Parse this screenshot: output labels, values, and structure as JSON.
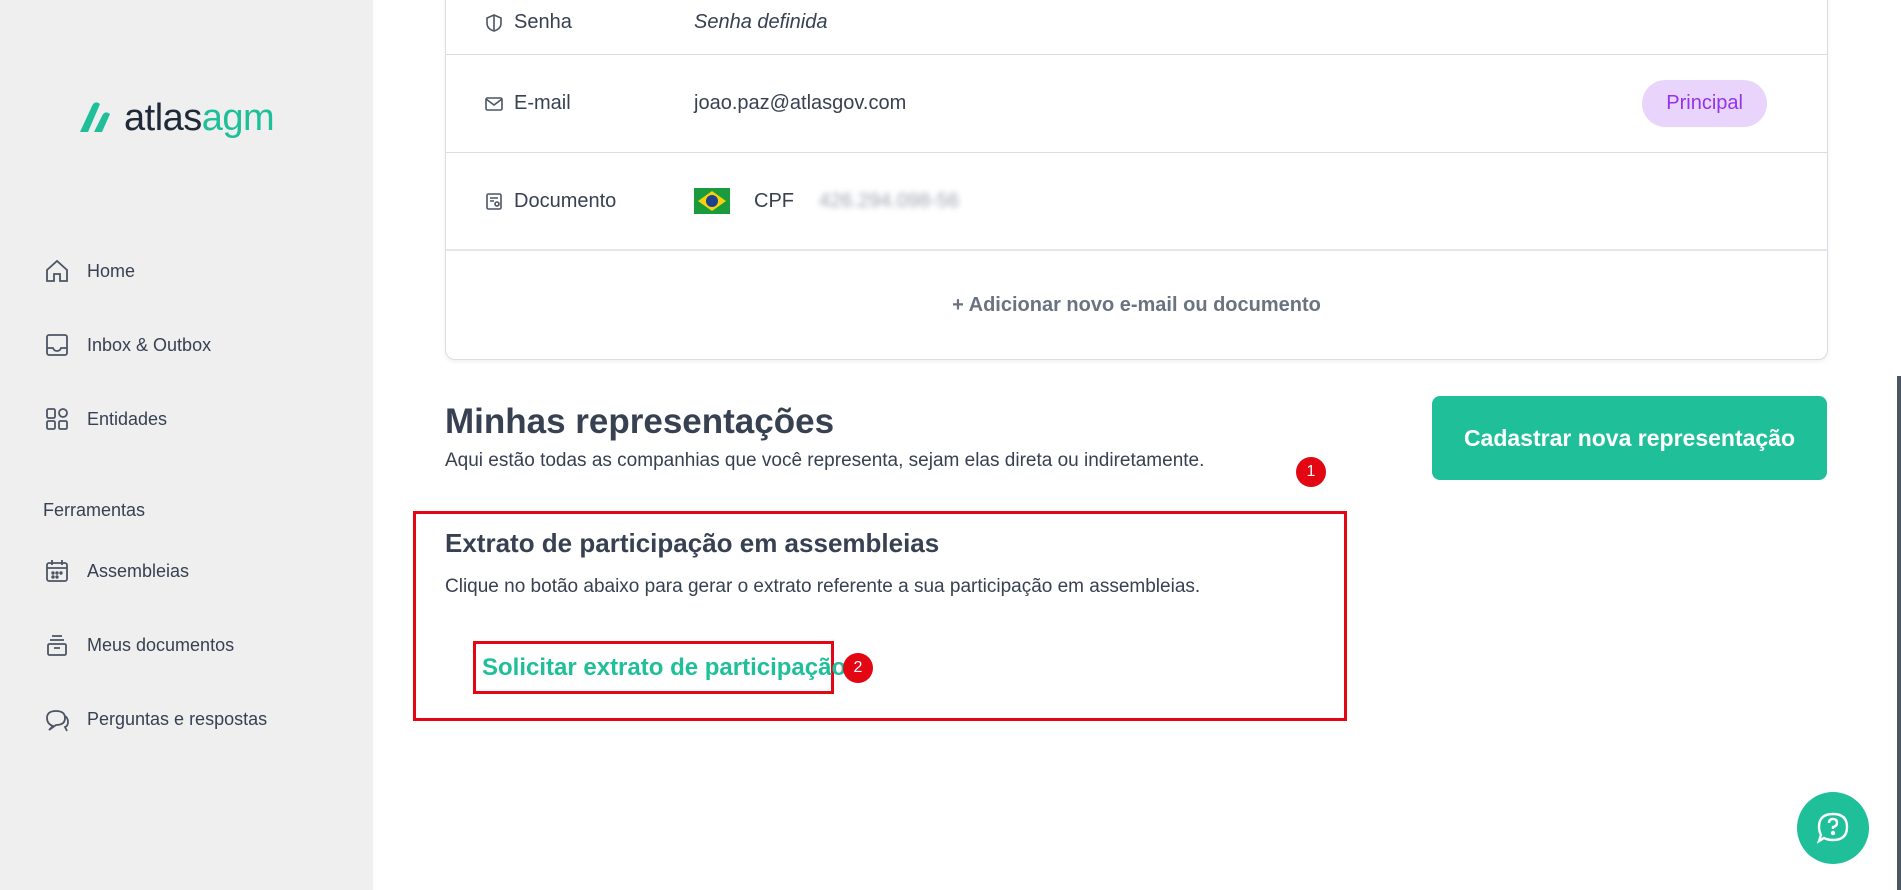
{
  "app": {
    "logo_prefix": "atlas",
    "logo_suffix": "agm",
    "brand_color": "#1fbf9a"
  },
  "sidebar": {
    "items": [
      {
        "label": "Home",
        "icon": "home-icon"
      },
      {
        "label": "Inbox & Outbox",
        "icon": "inbox-icon"
      },
      {
        "label": "Entidades",
        "icon": "grid-icon"
      }
    ],
    "section_label": "Ferramentas",
    "tools": [
      {
        "label": "Assembleias",
        "icon": "calendar-icon"
      },
      {
        "label": "Meus documentos",
        "icon": "archive-icon"
      },
      {
        "label": "Perguntas e respostas",
        "icon": "chat-icon"
      }
    ]
  },
  "account": {
    "senha_label": "Senha",
    "senha_value": "Senha definida",
    "email_label": "E-mail",
    "email_value": "joao.paz@atlasgov.com",
    "email_badge": "Principal",
    "doc_label": "Documento",
    "doc_type": "CPF",
    "doc_value": "426.294.098-56",
    "add_link": "+ Adicionar novo e-mail ou documento"
  },
  "representacoes": {
    "title": "Minhas representações",
    "subtitle": "Aqui estão todas as companhias que você representa, sejam elas direta ou indiretamente.",
    "cta_label": "Cadastrar nova representação"
  },
  "extrato": {
    "title": "Extrato de participação em assembleias",
    "subtitle": "Clique no botão abaixo para gerar o extrato referente a sua participação em assembleias.",
    "link_label": "Solicitar extrato de participação"
  },
  "annotations": {
    "one": "1",
    "two": "2",
    "color": "#e30613"
  }
}
